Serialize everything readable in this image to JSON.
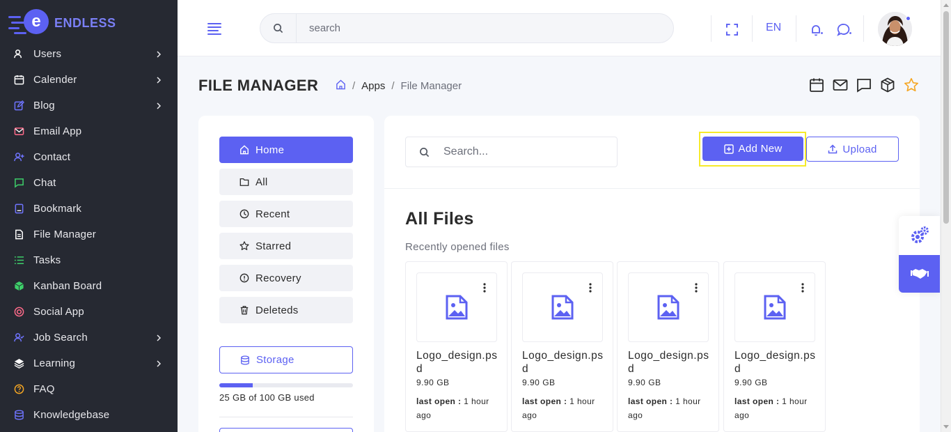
{
  "brand": {
    "name": "ENDLESS",
    "logo_letter": "e",
    "accent": "#5c61f2"
  },
  "sidebar": {
    "items": [
      {
        "label": "Users",
        "icon": "users-icon",
        "chevron": true
      },
      {
        "label": "Calender",
        "icon": "calendar-icon",
        "chevron": true
      },
      {
        "label": "Blog",
        "icon": "edit-icon",
        "chevron": true
      },
      {
        "label": "Email App",
        "icon": "mail-icon",
        "chevron": false
      },
      {
        "label": "Contact",
        "icon": "user-plus-icon",
        "chevron": false
      },
      {
        "label": "Chat",
        "icon": "chat-icon",
        "chevron": false
      },
      {
        "label": "Bookmark",
        "icon": "bookmark-icon",
        "chevron": false
      },
      {
        "label": "File Manager",
        "icon": "file-icon",
        "chevron": false
      },
      {
        "label": "Tasks",
        "icon": "list-icon",
        "chevron": false
      },
      {
        "label": "Kanban Board",
        "icon": "box-icon",
        "chevron": false
      },
      {
        "label": "Social App",
        "icon": "target-icon",
        "chevron": false
      },
      {
        "label": "Job Search",
        "icon": "user-check-icon",
        "chevron": true
      },
      {
        "label": "Learning",
        "icon": "layers-icon",
        "chevron": true
      },
      {
        "label": "FAQ",
        "icon": "help-icon",
        "chevron": false
      },
      {
        "label": "Knowledgebase",
        "icon": "database-icon",
        "chevron": false
      }
    ]
  },
  "header": {
    "search_placeholder": "search",
    "language": "EN"
  },
  "page": {
    "title": "FILE MANAGER",
    "breadcrumb": {
      "apps": "Apps",
      "current": "File Manager"
    }
  },
  "file_nav": {
    "home": "Home",
    "all": "All",
    "recent": "Recent",
    "starred": "Starred",
    "recovery": "Recovery",
    "deleteds": "Deleteds",
    "storage": "Storage",
    "storage_used_fraction": 0.25,
    "storage_text": "25 GB of 100 GB used"
  },
  "main": {
    "search_placeholder": "Search...",
    "add_new": "Add New",
    "upload": "Upload",
    "heading": "All Files",
    "subheading": "Recently opened files",
    "files": [
      {
        "name": "Logo_design.psd",
        "size": "9.90 GB",
        "last_open_label": "last open :",
        "last_open_value": "1 hour ago"
      },
      {
        "name": "Logo_design.psd",
        "size": "9.90 GB",
        "last_open_label": "last open :",
        "last_open_value": "1 hour ago"
      },
      {
        "name": "Logo_design.psd",
        "size": "9.90 GB",
        "last_open_label": "last open :",
        "last_open_value": "1 hour ago"
      },
      {
        "name": "Logo_design.psd",
        "size": "9.90 GB",
        "last_open_label": "last open :",
        "last_open_value": "1 hour ago"
      }
    ]
  }
}
